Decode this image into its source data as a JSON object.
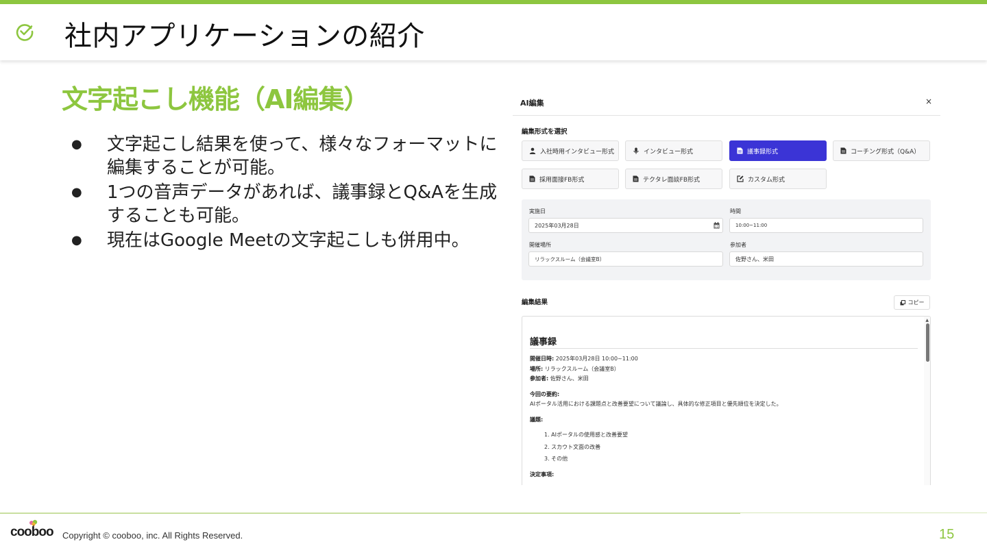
{
  "colors": {
    "accent": "#8dc63f",
    "button_active": "#3b34d6"
  },
  "header": {
    "title": "社内アプリケーションの紹介",
    "icon": "check-circle-icon"
  },
  "section": {
    "title": "文字起こし機能（AI編集）",
    "bullets": [
      "文字起こし結果を使って、様々なフォーマットに編集することが可能。",
      "1つの音声データがあれば、議事録とQ&Aを生成することも可能。",
      "現在はGoogle Meetの文字起こしも併用中。"
    ]
  },
  "modal": {
    "title": "AI編集",
    "close": "×",
    "format_label": "編集形式を選択",
    "formats": [
      {
        "label": "入社時用インタビュー形式",
        "icon": "user-icon"
      },
      {
        "label": "インタビュー形式",
        "icon": "microphone-icon"
      },
      {
        "label": "議事録形式",
        "icon": "document-icon",
        "active": true
      },
      {
        "label": "コーチング形式（Q&A）",
        "icon": "document-icon"
      },
      {
        "label": "採用面接FB形式",
        "icon": "document-icon"
      },
      {
        "label": "テクタレ面談FB形式",
        "icon": "document-icon"
      },
      {
        "label": "カスタム形式",
        "icon": "edit-icon"
      }
    ],
    "fields": {
      "date_label": "実施日",
      "date_value": "2025年03月28日",
      "time_label": "時間",
      "time_value": "10:00~11:00",
      "place_label": "開催場所",
      "place_value": "リラックスルーム（会議室B）",
      "participants_label": "参加者",
      "participants_value": "佐野さん、米田"
    },
    "result_label": "編集結果",
    "copy_label": "コピー",
    "document": {
      "heading": "議事録",
      "datetime_key": "開催日時:",
      "datetime_val": " 2025年03月28日 10:00~11:00",
      "place_key": "場所:",
      "place_val": " リラックスルーム（会議室B）",
      "participants_key": "参加者:",
      "participants_val": " 佐野さん、米田",
      "summary_key": "今回の要約:",
      "summary_val": "AIポータル活用における課題点と改善要望について議論し、具体的な修正項目と優先順位を決定した。",
      "agenda_key": "議題:",
      "agenda": [
        "1. AIポータルの使用感と改善要望",
        "2. スカウト文面の改善",
        "3. その他"
      ],
      "decisions_key": "決定事項:"
    }
  },
  "footer": {
    "logo": "cooboo",
    "copyright": "Copyright ©  cooboo, inc. All Rights Reserved.",
    "page_number": "15"
  }
}
